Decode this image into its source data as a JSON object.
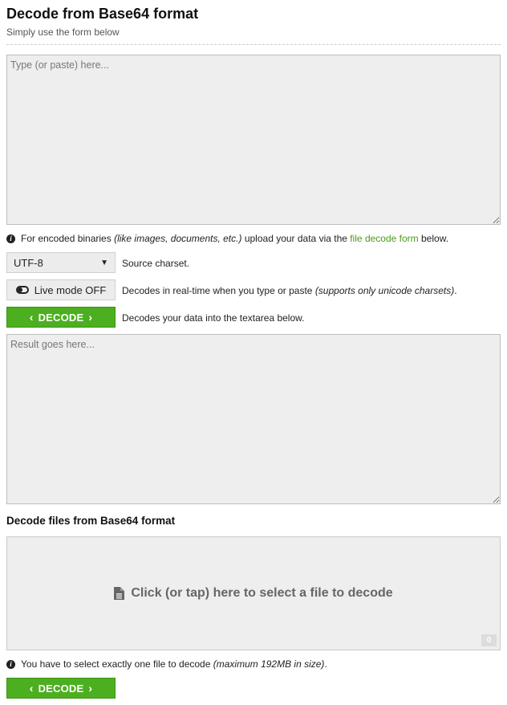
{
  "header": {
    "title": "Decode from Base64 format",
    "subtitle": "Simply use the form below"
  },
  "input_area": {
    "placeholder": "Type (or paste) here...",
    "value": ""
  },
  "binaries_note": {
    "prefix": "For encoded binaries",
    "emphasis": "(like images, documents, etc.)",
    "middle": "upload your data via the",
    "link_text": "file decode form",
    "suffix": "below."
  },
  "charset": {
    "selected": "UTF-8",
    "description": "Source charset."
  },
  "live_mode": {
    "label": "Live mode OFF",
    "description": "Decodes in real-time when you type or paste",
    "description_emphasis": "(supports only unicode charsets)",
    "description_end": "."
  },
  "decode_button": {
    "label": "DECODE",
    "description": "Decodes your data into the textarea below."
  },
  "result_area": {
    "placeholder": "Result goes here...",
    "value": ""
  },
  "files_section": {
    "title": "Decode files from Base64 format",
    "dropzone_text": "Click (or tap) here to select a file to decode",
    "file_count": "0",
    "note_prefix": "You have to select exactly one file to decode",
    "note_emphasis": "(maximum 192MB in size)",
    "note_end": ".",
    "button_label": "DECODE"
  },
  "colors": {
    "accent_green": "#4caf1f",
    "link_green": "#4a9a1a",
    "field_bg": "#eeeeee"
  },
  "icons": [
    "info-icon",
    "toggle-icon",
    "chevron-left-icon",
    "chevron-right-icon",
    "document-icon"
  ]
}
